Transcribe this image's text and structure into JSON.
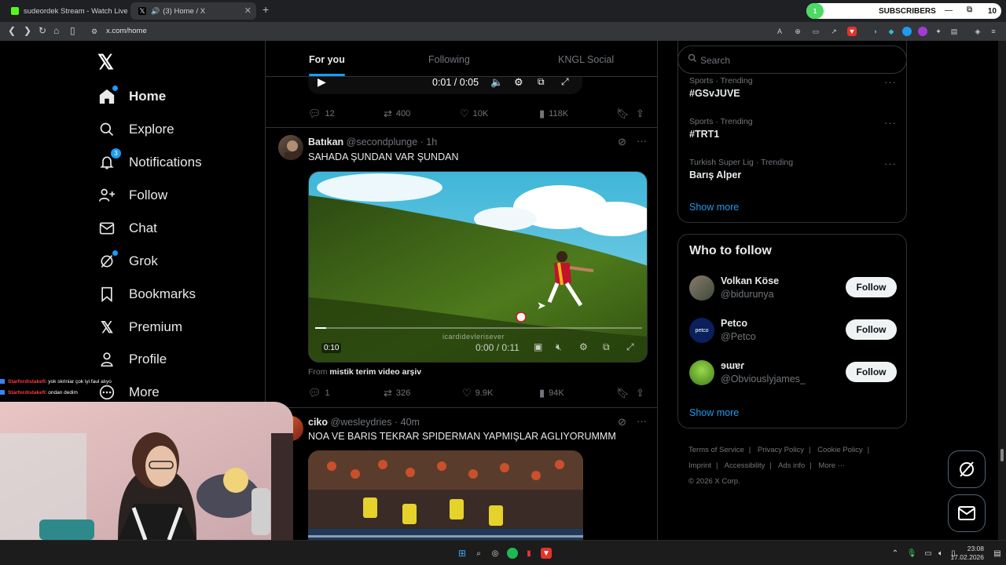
{
  "browser": {
    "tabs": [
      {
        "title": "sudeordek Stream - Watch Live o"
      },
      {
        "title": "(3) Home / X"
      }
    ],
    "url": "x.com/home",
    "subscribers_widget": {
      "label": "SUBSCRIBERS",
      "count": "10",
      "badge": "1"
    }
  },
  "nav": {
    "items": [
      {
        "label": "Home",
        "icon": "home-icon"
      },
      {
        "label": "Explore",
        "icon": "search-icon"
      },
      {
        "label": "Notifications",
        "icon": "bell-icon",
        "badge": "3"
      },
      {
        "label": "Follow",
        "icon": "person-plus-icon"
      },
      {
        "label": "Chat",
        "icon": "mail-icon"
      },
      {
        "label": "Grok",
        "icon": "grok-icon"
      },
      {
        "label": "Bookmarks",
        "icon": "bookmark-icon"
      },
      {
        "label": "Premium",
        "icon": "x-icon"
      },
      {
        "label": "Profile",
        "icon": "person-icon"
      },
      {
        "label": "More",
        "icon": "more-circle-icon"
      }
    ]
  },
  "feed": {
    "tabs": [
      "For you",
      "Following",
      "KNGL Social"
    ],
    "prev_post": {
      "player_time": "0:01 / 0:05",
      "replies": "12",
      "reposts": "400",
      "likes": "10K",
      "views": "118K"
    },
    "post1": {
      "name": "Batıkan",
      "handle": "@secondplunge",
      "time": "· 1h",
      "text": "SAHADA ŞUNDAN VAR ŞUNDAN",
      "video_watermark": "icardidevlerisever",
      "video_duration": "0:10",
      "video_time": "0:00 / 0:11",
      "from_label": "From",
      "from_source": "mistik terim video arşiv",
      "replies": "1",
      "reposts": "326",
      "likes": "9.9K",
      "views": "94K"
    },
    "post2": {
      "name": "ciko",
      "handle": "@wesleydries",
      "time": "· 40m",
      "text": "NOA VE BARIS TEKRAR SPIDERMAN YAPMIŞLAR AGLIYORUMMM"
    }
  },
  "sidebar": {
    "search_placeholder": "Search",
    "trends": [
      {
        "context": "Sports · Trending",
        "title": "#GSvJUVE"
      },
      {
        "context": "Sports · Trending",
        "title": "#TRT1"
      },
      {
        "context": "Turkish Super Lig · Trending",
        "title": "Barış Alper"
      }
    ],
    "show_more": "Show more",
    "who_to_follow": {
      "title": "Who to follow",
      "users": [
        {
          "name": "Volkan Köse",
          "handle": "@bidurunya",
          "button": "Follow"
        },
        {
          "name": "Petco",
          "handle": "@Petco",
          "button": "Follow",
          "avatar_text": "petco"
        },
        {
          "name": "ɘɯɐɾ",
          "handle": "@Obviouslyjames_",
          "button": "Follow"
        }
      ],
      "show_more": "Show more"
    },
    "footer": [
      "Terms of Service",
      "|",
      "Privacy Policy",
      "|",
      "Cookie Policy",
      "|",
      "Imprint",
      "|",
      "Accessibility",
      "|",
      "Ads info",
      "|",
      "More ···",
      "© 2026 X Corp."
    ]
  },
  "stream_chat": [
    {
      "user": "Starfordistakefi",
      "message": ": yok skriniar çok iyi faul alıyo"
    },
    {
      "user": "Starfordistakefi",
      "message": ": ondan dedim"
    }
  ],
  "taskbar": {
    "time": "23:08",
    "date": "17.02.2026"
  },
  "colors": {
    "accent": "#1d9bf0",
    "background": "#000000",
    "border": "#2f3336",
    "muted": "#71767b"
  }
}
